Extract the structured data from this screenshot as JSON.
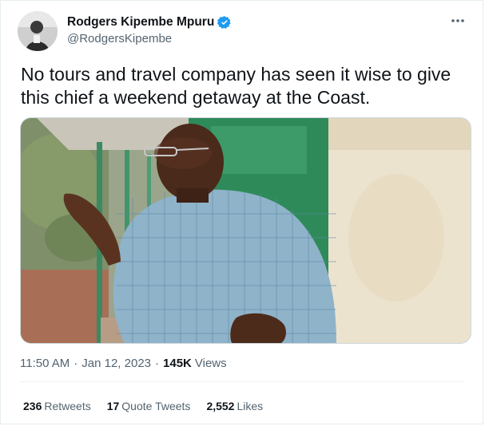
{
  "author": {
    "display_name": "Rodgers Kipembe Mpuru",
    "handle": "@RodgersKipembe",
    "avatar_icon": "profile-photo",
    "verified_color": "#1d9bf0"
  },
  "tweet": {
    "text": "No tours and travel company has seen it wise to give this chief a weekend getaway at the Coast.",
    "media_description_icon": "photo"
  },
  "meta": {
    "time": "11:50 AM",
    "separator": "·",
    "date": "Jan 12, 2023",
    "views_separator": "·",
    "views_count": "145K",
    "views_label": "Views"
  },
  "stats": {
    "retweets_count": "236",
    "retweets_label": "Retweets",
    "quotes_count": "17",
    "quotes_label": "Quote Tweets",
    "likes_count": "2,552",
    "likes_label": "Likes"
  },
  "more_icon": "more-icon"
}
